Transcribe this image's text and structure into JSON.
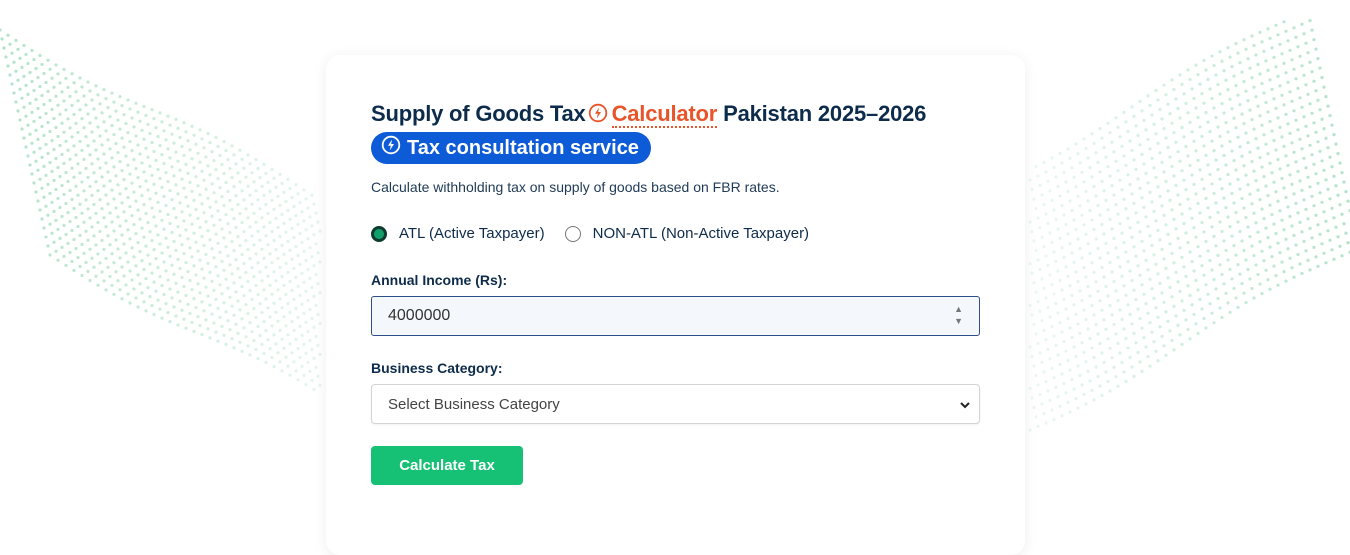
{
  "title": {
    "prefix": "Supply of Goods Tax",
    "link_text": "Calculator",
    "suffix": "Pakistan 2025–2026",
    "badge_text": "Tax consultation service"
  },
  "description": "Calculate withholding tax on supply of goods based on FBR rates.",
  "taxpayer_status": {
    "options": [
      {
        "label": "ATL (Active Taxpayer)",
        "selected": true
      },
      {
        "label": "NON-ATL (Non-Active Taxpayer)",
        "selected": false
      }
    ]
  },
  "income": {
    "label": "Annual Income (Rs):",
    "value": "4000000"
  },
  "category": {
    "label": "Business Category:",
    "selected": "Select Business Category"
  },
  "calculate_button": "Calculate Tax",
  "icons": {
    "title_icon": "lightning-bolt-icon",
    "badge_icon": "lightning-bolt-icon",
    "select_icon": "chevron-down-icon",
    "spinner_icon": "up-down-arrows-icon"
  },
  "colors": {
    "title": "#0d2b4a",
    "accent_orange": "#e8552a",
    "badge_blue": "#0d5bd7",
    "button_green": "#16c074",
    "dots_green": "#9fdcbc"
  }
}
